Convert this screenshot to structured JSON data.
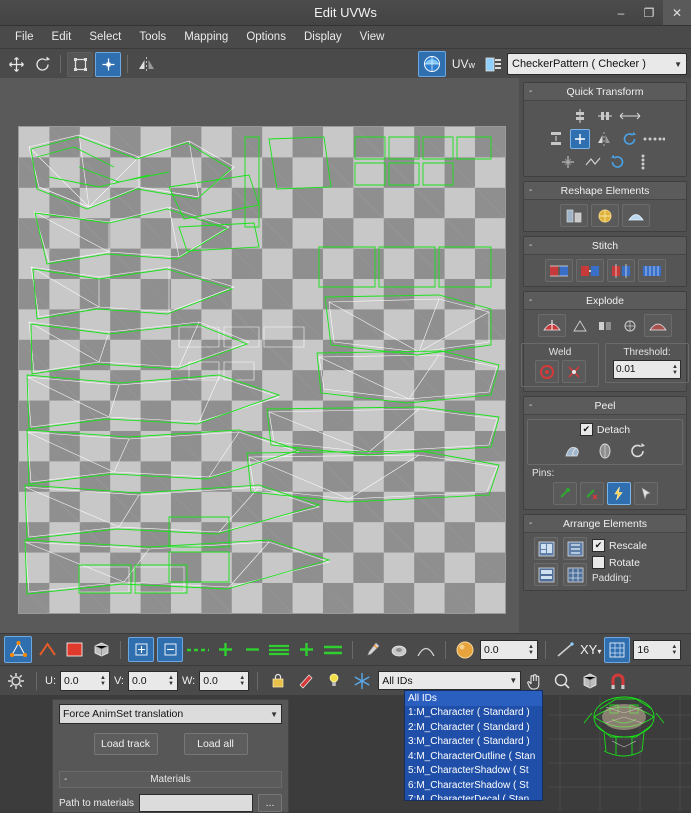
{
  "window": {
    "title": "Edit UVWs",
    "buttons": {
      "minimize": "–",
      "maximize": "❐",
      "close": "✕"
    }
  },
  "menu": {
    "items": [
      "File",
      "Edit",
      "Select",
      "Tools",
      "Mapping",
      "Options",
      "Display",
      "View"
    ]
  },
  "toolbar": {
    "icons": [
      "move-icon",
      "rotate-icon",
      "scale-icon",
      "freeform-mode-icon",
      "mirror-icon"
    ],
    "uv_label": "UV",
    "texture_list_icon": "texture-list-icon",
    "material_combo": "CheckerPattern  ( Checker )"
  },
  "rollouts": [
    {
      "id": "quick-transform",
      "title": "Quick Transform"
    },
    {
      "id": "reshape-elements",
      "title": "Reshape Elements"
    },
    {
      "id": "stitch",
      "title": "Stitch"
    },
    {
      "id": "explode",
      "title": "Explode"
    },
    {
      "id": "peel",
      "title": "Peel"
    },
    {
      "id": "arrange-elements",
      "title": "Arrange Elements"
    }
  ],
  "explode": {
    "weld_label": "Weld",
    "threshold_label": "Threshold:",
    "threshold_value": "0.01"
  },
  "peel": {
    "detach_label": "Detach",
    "detach_checked": true,
    "pins_label": "Pins:"
  },
  "arrange": {
    "rescale_label": "Rescale",
    "rescale_checked": true,
    "rotate_label": "Rotate",
    "rotate_checked": false,
    "padding_label": "Padding:"
  },
  "bottom_toolbar": {
    "snap_value": "0.0",
    "axis_label": "XY",
    "grid_value": "16"
  },
  "status_bar": {
    "u_label": "U:",
    "u_value": "0.0",
    "v_label": "V:",
    "v_value": "0.0",
    "w_label": "W:",
    "w_value": "0.0",
    "id_combo": "All IDs",
    "icons": [
      "lock-icon",
      "paint-select-icon",
      "light-icon",
      "snowflake-icon",
      "pan-icon",
      "zoom-region-icon",
      "cube-icon",
      "magnet-icon"
    ]
  },
  "id_list": {
    "items": [
      "All IDs",
      "1:M_Character  ( Standard )",
      "2:M_Character  ( Standard )",
      "3:M_Character  ( Standard )",
      "4:M_CharacterOutline  ( Stan",
      "5:M_CharacterShadow  ( St",
      "6:M_CharacterShadow  ( St",
      "7:M_CharacterDecal  ( Stan"
    ],
    "selected_index": 0
  },
  "lower_panel": {
    "anim_combo": "Force AnimSet translation",
    "load_track_label": "Load track",
    "load_all_label": "Load all",
    "materials_title": "Materials",
    "path_label": "Path to materials",
    "path_value": "",
    "browse_label": "..."
  },
  "colors": {
    "accent": "#2f6fb0",
    "uv_green": "#19e219",
    "uv_white": "#ffffff",
    "panel": "#4f4f4f",
    "list_blue": "#1f4fa8"
  }
}
